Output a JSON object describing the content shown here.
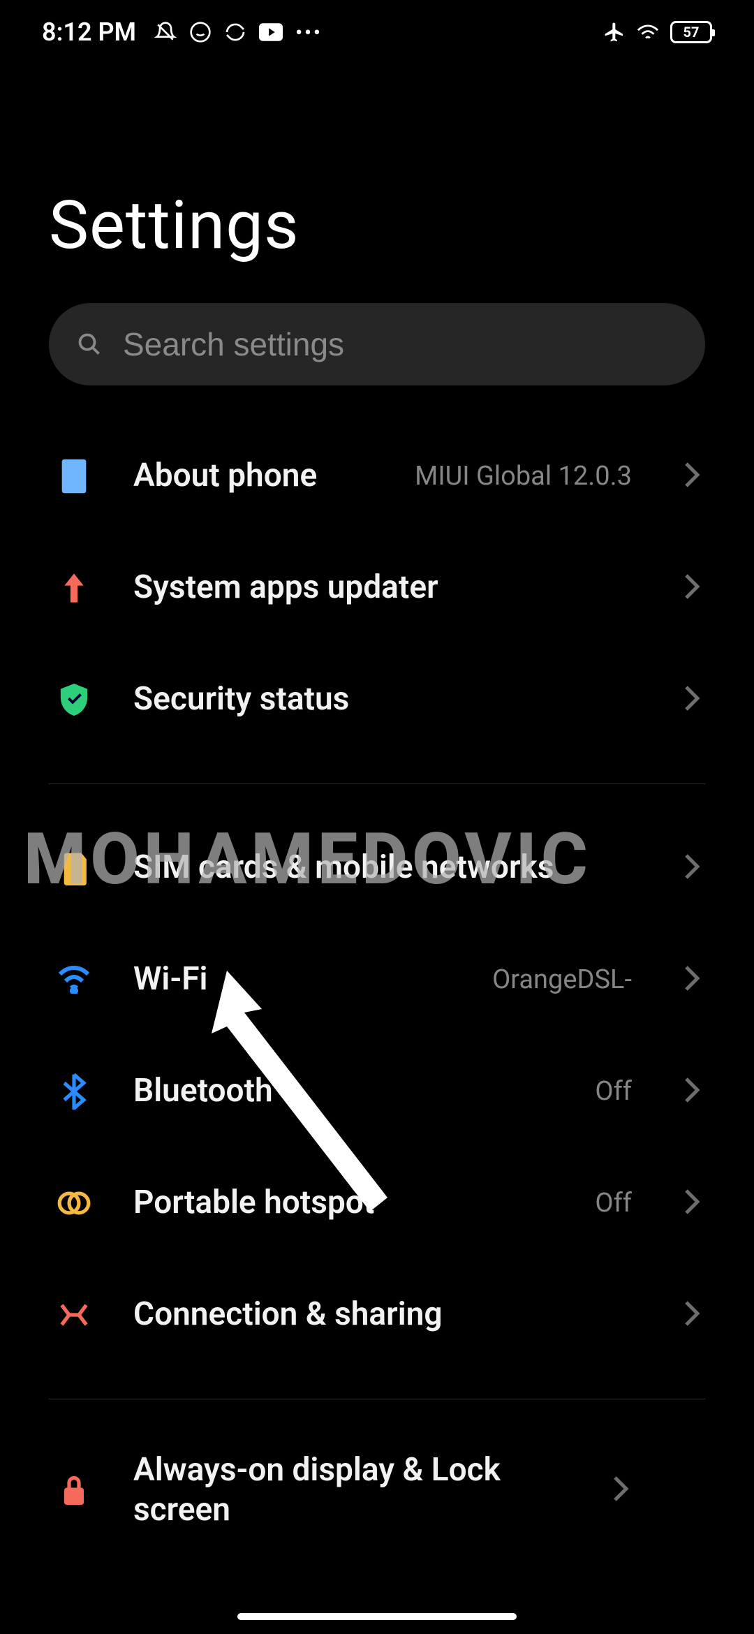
{
  "status": {
    "time": "8:12 PM",
    "battery": "57"
  },
  "title": "Settings",
  "search": {
    "placeholder": "Search settings"
  },
  "items": [
    {
      "label": "About phone",
      "value": "MIUI Global 12.0.3"
    },
    {
      "label": "System apps updater",
      "value": ""
    },
    {
      "label": "Security status",
      "value": ""
    },
    {
      "label": "SIM cards & mobile networks",
      "value": ""
    },
    {
      "label": "Wi-Fi",
      "value": "OrangeDSL-"
    },
    {
      "label": "Bluetooth",
      "value": "Off"
    },
    {
      "label": "Portable hotspot",
      "value": "Off"
    },
    {
      "label": "Connection & sharing",
      "value": ""
    },
    {
      "label": "Always-on display & Lock screen",
      "value": ""
    }
  ],
  "watermark": "MOHAMEDOVIC"
}
